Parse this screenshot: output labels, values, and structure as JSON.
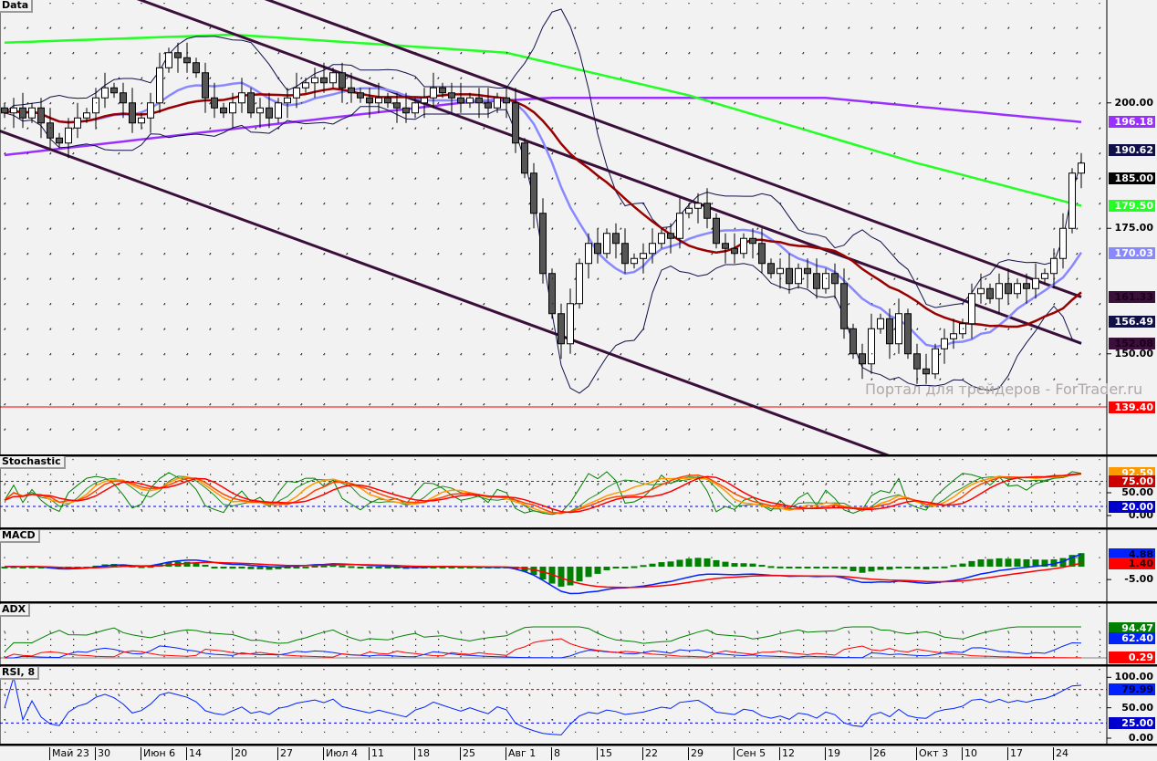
{
  "panels": {
    "main": "Data",
    "stoch": "Stochastic",
    "macd": "MACD",
    "adx": "ADX",
    "rsi": "RSI, 8"
  },
  "watermark": "Портал для трейдеров - ForTrader.ru",
  "axis_ticks": [
    {
      "panel": "main",
      "value": 200,
      "label": "200.00"
    },
    {
      "panel": "main",
      "value": 175,
      "label": "175.00"
    },
    {
      "panel": "main",
      "value": 150,
      "label": "150.00"
    },
    {
      "panel": "stoch",
      "value": 50,
      "label": "50.00"
    },
    {
      "panel": "stoch",
      "value": 0,
      "label": "0.00"
    },
    {
      "panel": "macd",
      "value": -5,
      "label": "-5.00"
    },
    {
      "panel": "rsi",
      "value": 100,
      "label": "100.00"
    },
    {
      "panel": "rsi",
      "value": 50,
      "label": "50.00"
    },
    {
      "panel": "rsi",
      "value": 0,
      "label": "0.00"
    }
  ],
  "value_tags": [
    {
      "panel": "main",
      "value": 196.18,
      "label": "196.18",
      "bg": "#9a30ff",
      "fg": "#ffffff"
    },
    {
      "panel": "main",
      "value": 190.62,
      "label": "190.62",
      "bg": "#101048",
      "fg": "#ffffff"
    },
    {
      "panel": "main",
      "value": 185.0,
      "label": "185.00",
      "bg": "#000000",
      "fg": "#ffffff"
    },
    {
      "panel": "main",
      "value": 179.5,
      "label": "179.50",
      "bg": "#22ff22",
      "fg": "#ffffff"
    },
    {
      "panel": "main",
      "value": 170.03,
      "label": "170.03",
      "bg": "#8888ff",
      "fg": "#ffffff"
    },
    {
      "panel": "main",
      "value": 161.33,
      "label": "161.33",
      "bg": "#3a0f3a",
      "fg": "#1a001a"
    },
    {
      "panel": "main",
      "value": 156.49,
      "label": "156.49",
      "bg": "#101048",
      "fg": "#ffffff"
    },
    {
      "panel": "main",
      "value": 152.08,
      "label": "152.08",
      "bg": "#3a0f3a",
      "fg": "#1a001a"
    },
    {
      "panel": "main",
      "value": 139.4,
      "label": "139.40",
      "bg": "#ff0000",
      "fg": "#ffffff"
    },
    {
      "panel": "stoch",
      "value": 92.59,
      "label": "92.59",
      "bg": "#ff9900",
      "fg": "#ffffff"
    },
    {
      "panel": "stoch",
      "value": 75.0,
      "label": "75.00",
      "bg": "#cc0000",
      "fg": "#ffffff"
    },
    {
      "panel": "stoch",
      "value": 20.0,
      "label": "20.00",
      "bg": "#0000cc",
      "fg": "#ffffff"
    },
    {
      "panel": "macd",
      "value": 4.88,
      "label": "4.88",
      "bg": "#0022ff",
      "fg": "#000033"
    },
    {
      "panel": "macd",
      "value": 1.4,
      "label": "1.40",
      "bg": "#ff0000",
      "fg": "#330000"
    },
    {
      "panel": "adx",
      "value": 94.47,
      "label": "94.47",
      "bg": "#008000",
      "fg": "#ffffff"
    },
    {
      "panel": "adx",
      "value": 62.4,
      "label": "62.40",
      "bg": "#0022ff",
      "fg": "#ffffff"
    },
    {
      "panel": "adx",
      "value": 0.29,
      "label": "0.29",
      "bg": "#ff0000",
      "fg": "#ffffff"
    },
    {
      "panel": "rsi",
      "value": 79.99,
      "label": "79.99",
      "bg": "#0022ff",
      "fg": "#000033"
    },
    {
      "panel": "rsi",
      "value": 25.0,
      "label": "25.00",
      "bg": "#0000cc",
      "fg": "#ffffff"
    }
  ],
  "dates": [
    "Май 23",
    "30",
    "Июн 6",
    "14",
    "20",
    "27",
    "Июл 4",
    "11",
    "18",
    "25",
    "Авг 1",
    "8",
    "15",
    "22",
    "29",
    "Сен 5",
    "12",
    "19",
    "26",
    "Окт 3",
    "10",
    "17",
    "24"
  ],
  "chart_data": {
    "type": "candlestick",
    "title": "Data",
    "ylim": [
      130,
      220.5
    ],
    "closes": [
      198,
      199,
      197,
      199,
      196,
      193,
      192,
      195,
      197,
      198,
      201,
      203,
      202,
      200,
      196,
      197,
      200,
      207,
      210,
      209,
      208,
      206,
      201,
      199,
      198,
      200,
      202,
      198,
      199,
      197,
      200,
      201,
      203,
      204,
      205,
      204,
      206,
      203,
      202,
      201,
      200,
      201,
      200,
      199,
      198,
      200,
      201,
      203,
      202,
      201,
      200,
      201,
      200,
      199,
      201,
      200,
      192,
      186,
      178,
      166,
      158,
      152,
      160,
      168,
      172,
      170,
      174,
      172,
      168,
      169,
      170,
      172,
      174,
      173,
      178,
      179,
      180,
      177,
      172,
      171,
      170,
      173,
      172,
      168,
      166,
      167,
      164,
      167,
      166,
      163,
      166,
      164,
      155,
      150,
      148,
      155,
      157,
      152,
      158,
      150,
      147,
      146,
      151,
      153,
      154,
      156,
      162,
      163,
      161,
      164,
      162,
      164,
      163,
      165,
      166,
      169,
      175,
      186,
      188
    ],
    "support_line": 139.4,
    "long_ma_green": [
      [
        0,
        212
      ],
      [
        25,
        213.6
      ],
      [
        55,
        210
      ],
      [
        75,
        201.5
      ],
      [
        100,
        188
      ],
      [
        118,
        179.5
      ]
    ],
    "long_ma_purple": [
      [
        0,
        189.6
      ],
      [
        50,
        200
      ],
      [
        60,
        201
      ],
      [
        90,
        201
      ],
      [
        118,
        196.18
      ]
    ],
    "channel_lines": [
      [
        [
          0,
          239.7
        ],
        [
          118,
          161.33
        ]
      ],
      [
        [
          0,
          230.4
        ],
        [
          118,
          152.08
        ]
      ],
      [
        [
          -0.5,
          194.4
        ],
        [
          118,
          115.7
        ]
      ]
    ],
    "indicators": {
      "stochastic": {
        "levels": [
          75,
          20
        ],
        "range": [
          0,
          100
        ]
      },
      "macd": {
        "fast": 12,
        "slow": 26,
        "signal": 9
      },
      "adx": {
        "period": 8
      },
      "rsi": {
        "period": 8,
        "levels": [
          80,
          25
        ],
        "range": [
          0,
          100
        ]
      }
    }
  }
}
